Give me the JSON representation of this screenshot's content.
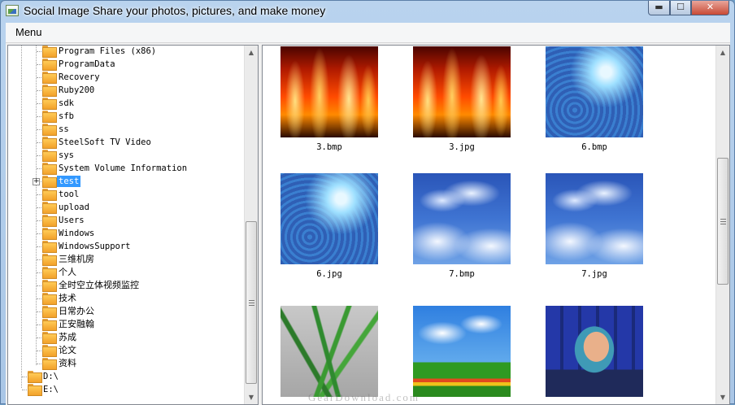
{
  "window": {
    "title": "Social Image Share your photos, pictures, and make money",
    "controls": {
      "minimize": "▬",
      "maximize": "☐",
      "close": "✕"
    }
  },
  "menubar": {
    "menu_label": "Menu"
  },
  "tree": {
    "items": [
      {
        "label": "Program Files (x86)"
      },
      {
        "label": "ProgramData"
      },
      {
        "label": "Recovery"
      },
      {
        "label": "Ruby200"
      },
      {
        "label": "sdk"
      },
      {
        "label": "sfb"
      },
      {
        "label": "ss"
      },
      {
        "label": "SteelSoft TV Video"
      },
      {
        "label": "sys"
      },
      {
        "label": "System Volume Information"
      },
      {
        "label": "test",
        "selected": true,
        "expandable": true
      },
      {
        "label": "tool"
      },
      {
        "label": "upload"
      },
      {
        "label": "Users"
      },
      {
        "label": "Windows"
      },
      {
        "label": "WindowsSupport"
      },
      {
        "label": "三维机房"
      },
      {
        "label": "个人"
      },
      {
        "label": "全时空立体视频监控"
      },
      {
        "label": "技术"
      },
      {
        "label": "日常办公"
      },
      {
        "label": "正安融翰"
      },
      {
        "label": "苏成"
      },
      {
        "label": "论文"
      },
      {
        "label": "资料"
      }
    ],
    "drives": [
      {
        "label": "D:\\"
      },
      {
        "label": "E:\\"
      }
    ]
  },
  "thumbnails": [
    {
      "caption": "3.bmp",
      "image": "fire"
    },
    {
      "caption": "3.jpg",
      "image": "fire"
    },
    {
      "caption": "6.bmp",
      "image": "water"
    },
    {
      "caption": "6.jpg",
      "image": "water"
    },
    {
      "caption": "7.bmp",
      "image": "sky"
    },
    {
      "caption": "7.jpg",
      "image": "sky"
    },
    {
      "caption": "",
      "image": "plant"
    },
    {
      "caption": "",
      "image": "field"
    },
    {
      "caption": "",
      "image": "person"
    }
  ],
  "watermark": "GearDownload.com"
}
